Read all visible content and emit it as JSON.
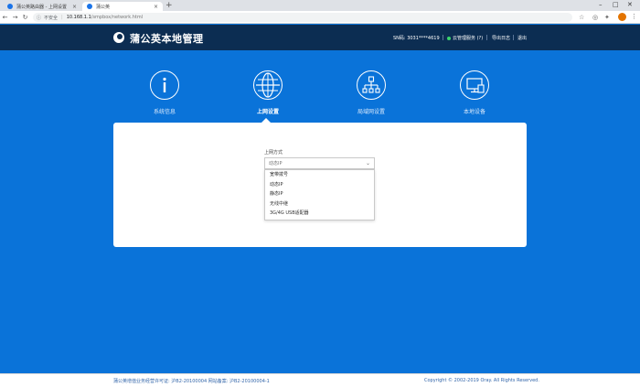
{
  "browser": {
    "tabs": [
      {
        "label": "蒲公英路由器 - 上网设置"
      },
      {
        "label": "蒲公英"
      }
    ],
    "new_tab": "+",
    "address": {
      "security_label": "不安全",
      "host": "10.168.1.1",
      "path": "/smpbox/network.html"
    }
  },
  "header": {
    "logo_text": "蒲公英本地管理",
    "sn_label": "SN码: 3031****4619",
    "cloud_status": "云管理服务 (?)",
    "export_log": "导出日志",
    "logout": "退出"
  },
  "nav": {
    "items": [
      {
        "label": "系统信息",
        "icon": "info-icon"
      },
      {
        "label": "上网设置",
        "icon": "globe-icon"
      },
      {
        "label": "局域网设置",
        "icon": "network-icon"
      },
      {
        "label": "本地设备",
        "icon": "monitor-icon"
      }
    ],
    "active_index": 1
  },
  "form": {
    "field_label": "上网方式",
    "selected": "动态IP",
    "options": [
      "宽带拨号",
      "动态IP",
      "静态IP",
      "无线中继",
      "3G/4G USB适配器"
    ]
  },
  "footer": {
    "icp": "蒲公英增值业务经营许可证: 沪B2-20100004 网站备案: 沪B2-20100004-1",
    "copyright": "Copyright © 2002-2019 Oray. All Rights Reserved."
  },
  "colors": {
    "page_bg": "#0a73d9",
    "header_bg": "#0c2d52",
    "status_green": "#3bd46b"
  }
}
